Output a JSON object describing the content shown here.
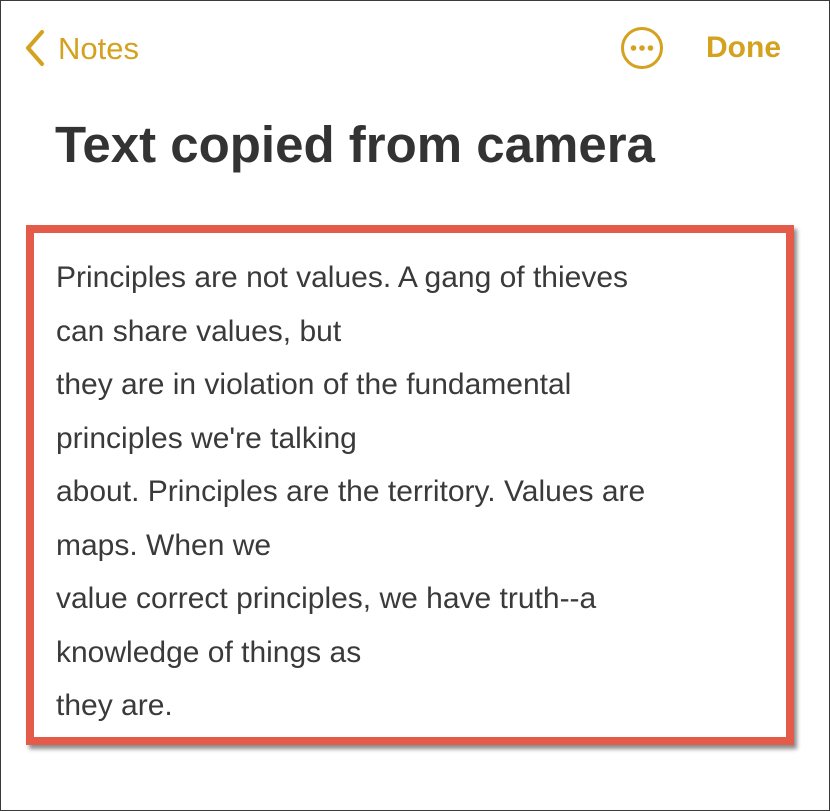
{
  "nav": {
    "back_label": "Notes",
    "done_label": "Done",
    "more_icon": "ellipsis-circle-icon",
    "back_icon": "chevron-left-icon",
    "accent_color": "#d4a21f"
  },
  "note": {
    "title": "Text copied from camera",
    "lines": [
      "Principles are not values. A gang of thieves",
      "can share values, but",
      "they are in violation of the fundamental",
      "principles we're talking",
      "about. Principles are the territory. Values are",
      "maps. When we",
      "value correct principles, we have truth--a",
      "knowledge of things as",
      "they are."
    ],
    "highlight_color": "#e55b4a"
  }
}
